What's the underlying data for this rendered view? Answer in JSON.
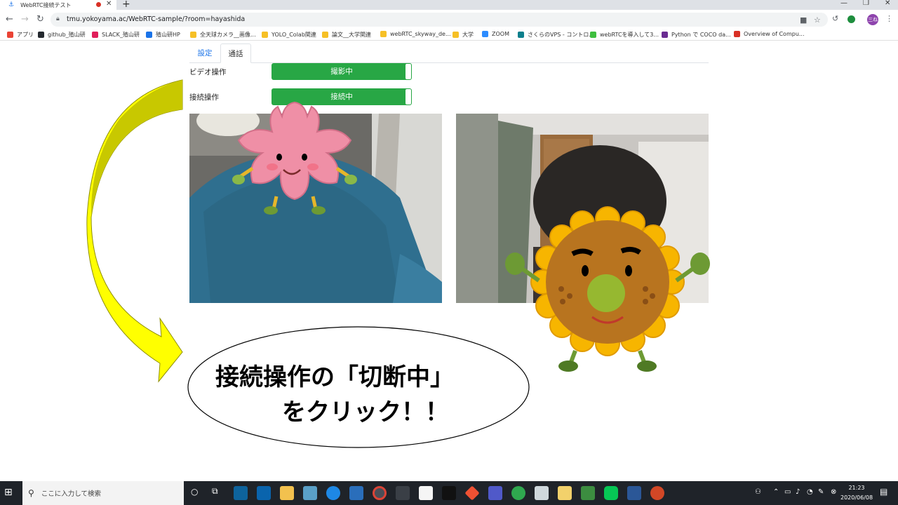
{
  "browser": {
    "tab_title": "WebRTC接続テスト",
    "url": "tmu.yokoyama.ac/WebRTC-sample/?room=hayashida",
    "profile_initials": "三ね"
  },
  "bookmarks": [
    {
      "label": "アプリ",
      "color": "#ea4335"
    },
    {
      "label": "github_殖山研",
      "color": "#24292e"
    },
    {
      "label": "SLACK_殖山研",
      "color": "#e01e5a"
    },
    {
      "label": "殖山研HP",
      "color": "#1a73e8"
    },
    {
      "label": "全天球カメラ__画像...",
      "color": "#f6c026"
    },
    {
      "label": "YOLO_Colab関連",
      "color": "#f6c026"
    },
    {
      "label": "論文__大学関連",
      "color": "#f6c026"
    },
    {
      "label": "webRTC_skyway_de...",
      "color": "#f6c026"
    },
    {
      "label": "大学",
      "color": "#f6c026"
    },
    {
      "label": "ZOOM",
      "color": "#2d8cff"
    },
    {
      "label": "さくらのVPS - コントロ...",
      "color": "#0d7f8c"
    },
    {
      "label": "webRTCを導入して3...",
      "color": "#3fbf3f"
    },
    {
      "label": "Python で COCO da...",
      "color": "#6a2c91"
    },
    {
      "label": "Overview of Compu...",
      "color": "#d93025"
    }
  ],
  "page": {
    "tabs": [
      {
        "label": "設定"
      },
      {
        "label": "通話"
      }
    ],
    "video_row": {
      "label": "ビデオ操作",
      "toggle_text": "撮影中"
    },
    "connection_row": {
      "label": "接続操作",
      "toggle_text": "接続中"
    }
  },
  "callout": {
    "line1": "接続操作の「切断中」",
    "line2": "をクリック！！"
  },
  "taskbar": {
    "search_placeholder": "ここに入力して検索",
    "time": "21:23",
    "date": "2020/06/08"
  },
  "colors": {
    "toggle_on": "#28a745",
    "arrow_fill": "#ffff00",
    "arrow_dark": "#c8c800"
  }
}
